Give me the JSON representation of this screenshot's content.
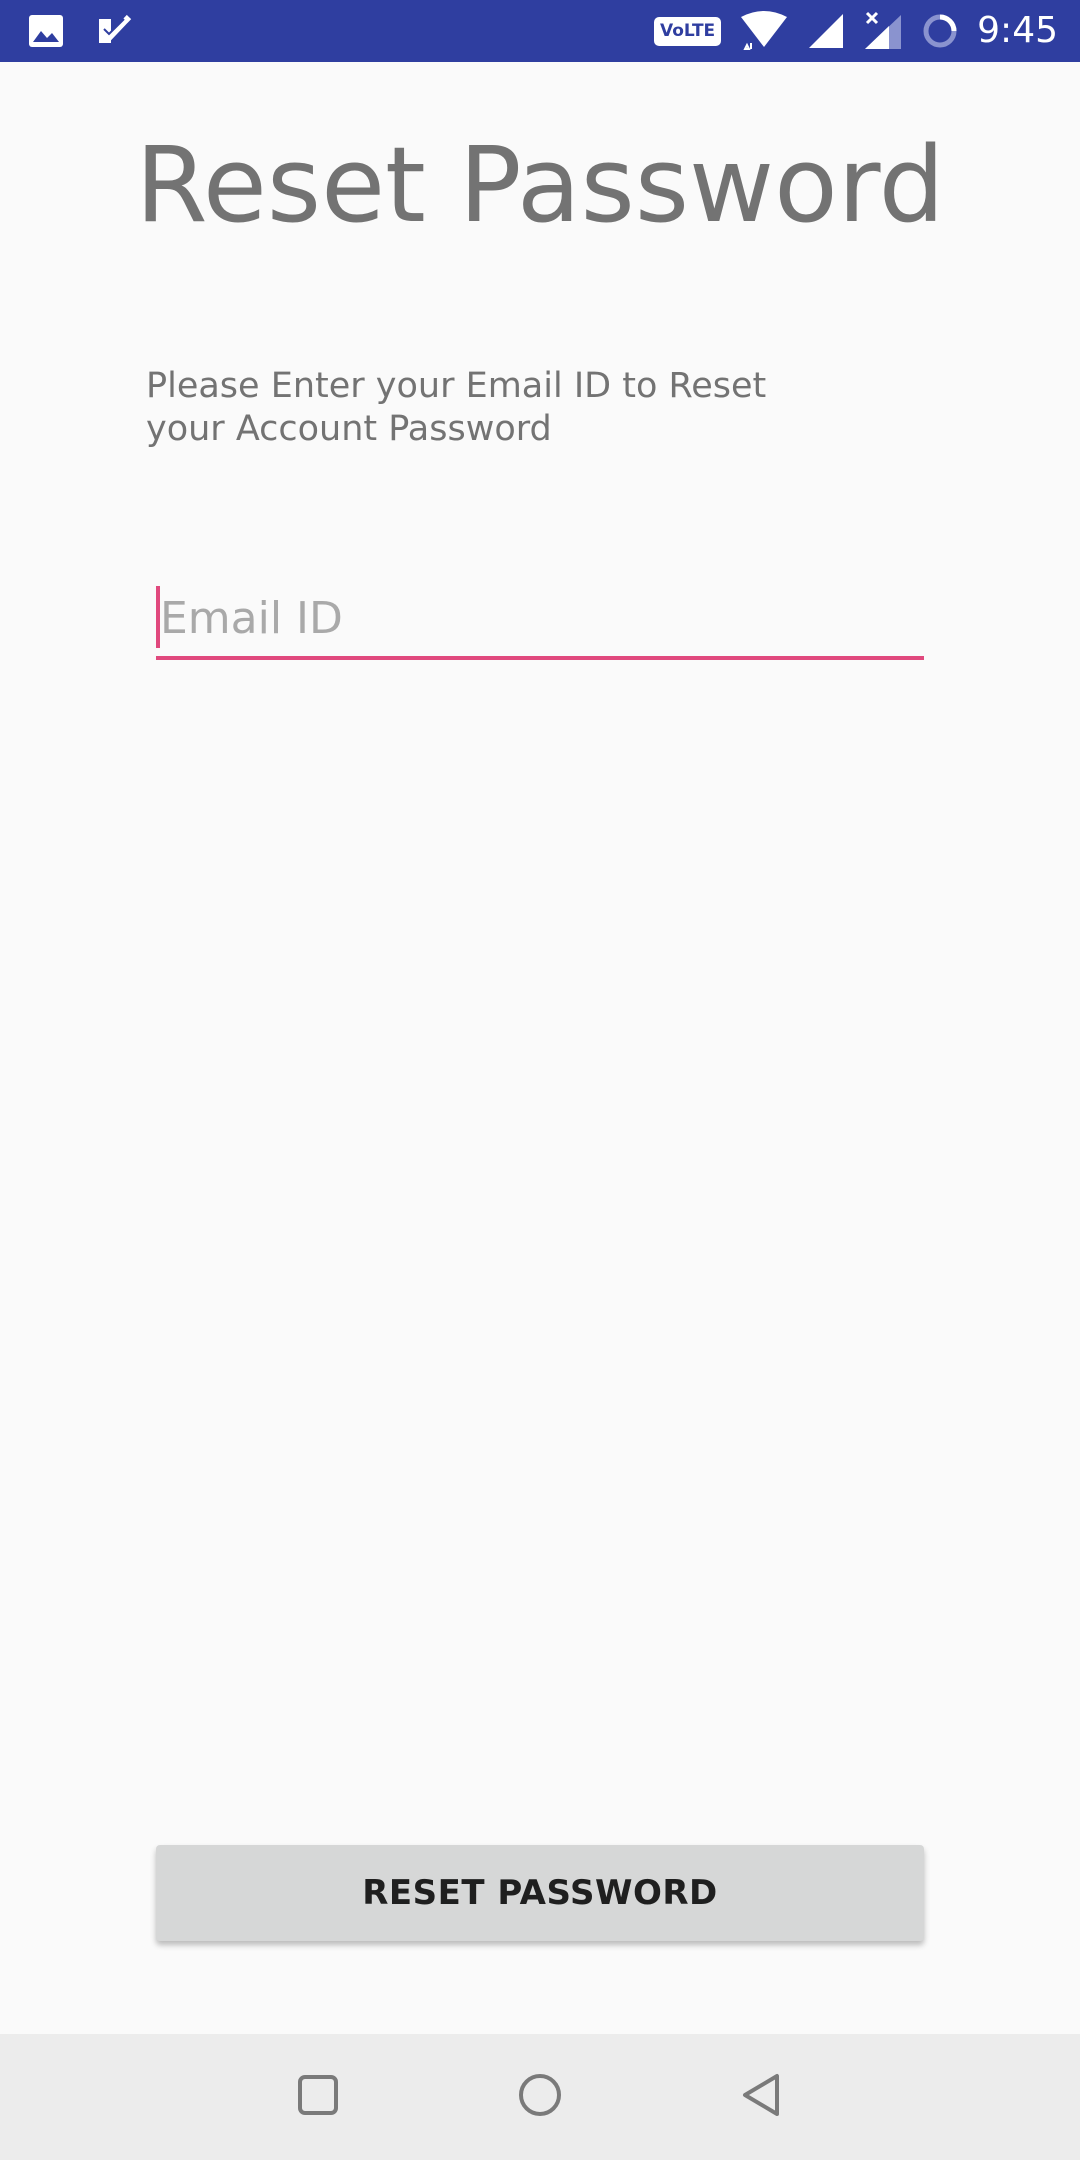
{
  "status_bar": {
    "time": "9:45",
    "network_badge": "VoLTE",
    "icons": [
      "gallery-icon",
      "check-notification-icon",
      "wifi-icon",
      "signal-icon",
      "signal-no-data-icon",
      "sync-icon"
    ],
    "background_color": "#2f3ea0"
  },
  "main": {
    "title": "Reset Password",
    "instructions": "Please Enter your Email ID to Reset your Account Password",
    "email": {
      "placeholder": "Email ID",
      "value": ""
    },
    "reset_button_label": "RESET PASSWORD",
    "accent_color": "#e0487d"
  },
  "nav_bar": {
    "buttons": [
      "recents-icon",
      "home-icon",
      "back-icon"
    ]
  }
}
